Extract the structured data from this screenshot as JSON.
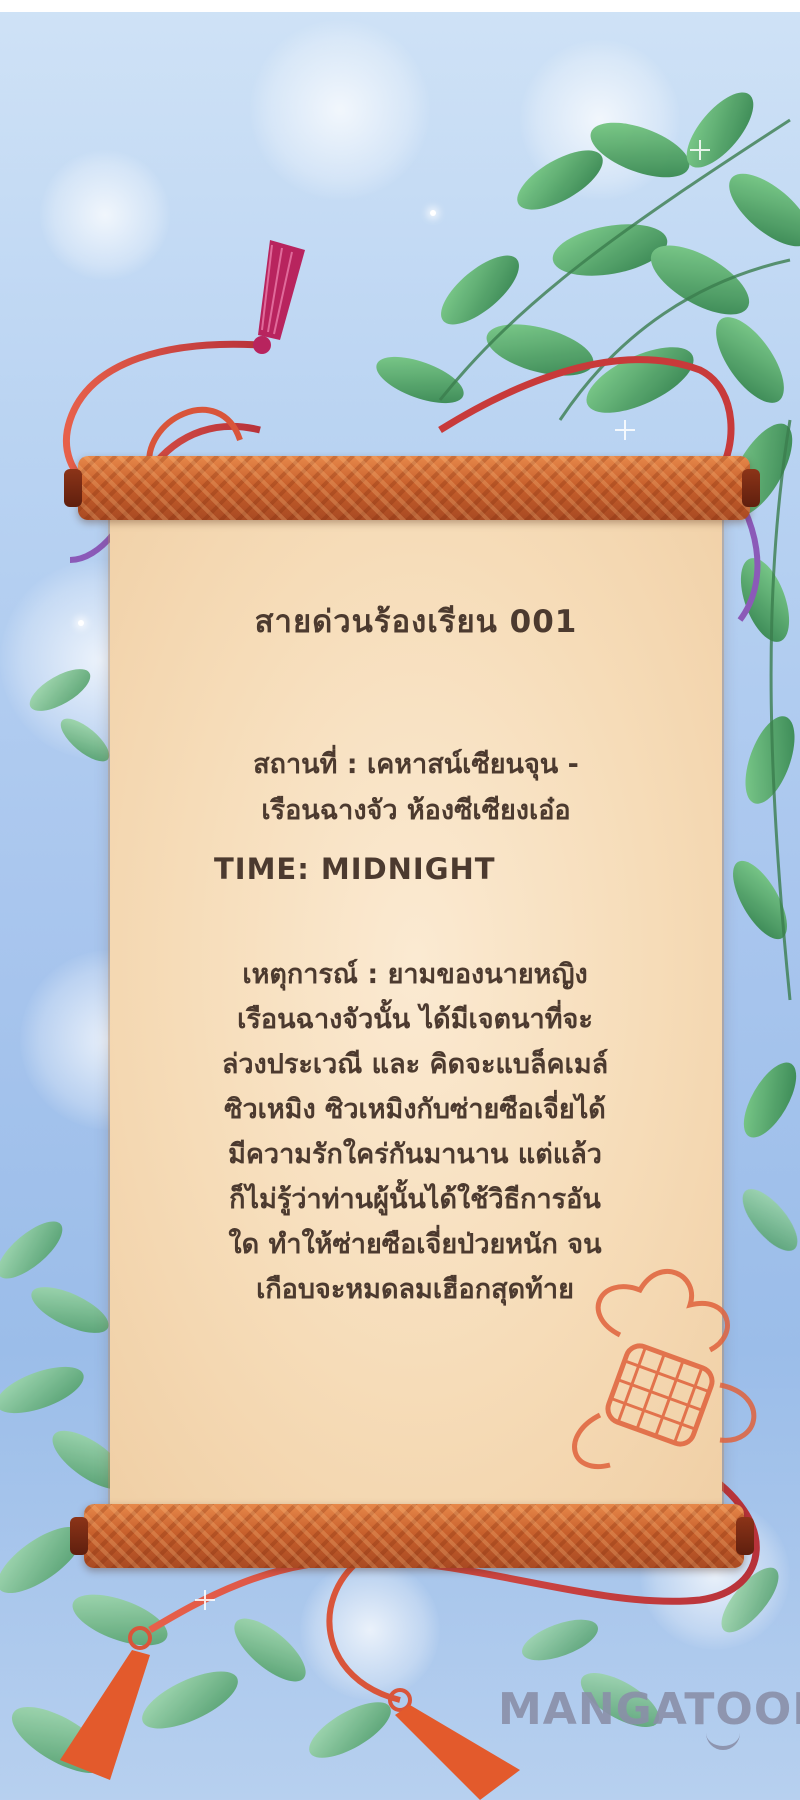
{
  "scroll": {
    "title": "สายด่วนร้องเรียน 001",
    "location_lines": [
      "สถานที่ : เคหาสน์เซียนจุน -",
      "เรือนฉางจัว ห้องซีเซียงเอ๋อ"
    ],
    "time": "TIME: MIDNIGHT",
    "event_lines": [
      "เหตุการณ์ : ยามของนายหญิง",
      "เรือนฉางจัวนั้น ได้มีเจตนาที่จะ",
      "ล่วงประเวณี และ คิดจะแบล็คเมล์",
      "ซิวเหมิง ซิวเหมิงกับซ่ายซือเจี่ยได้",
      "มีความรักใคร่กันมานาน แต่แล้ว",
      "ก็ไม่รู้ว่าท่านผู้นั้นได้ใช้วิธีการอัน",
      "ใด ทำให้ซ่ายซือเจี่ยป่วยหนัก จน",
      "เกือบจะหมดลมเฮือกสุดท้าย"
    ]
  },
  "watermark": "MANGATOON",
  "colors": {
    "sky": "#b9d3f2",
    "paper": "#f6dcb8",
    "rod": "#c8602c",
    "text": "#4c3a2f",
    "cord": "#d9553a",
    "tassel": "#b8245e",
    "leaf": "#3f9b52"
  },
  "icons": [
    "tassel-icon",
    "chinese-knot-icon",
    "leaf-icon"
  ]
}
